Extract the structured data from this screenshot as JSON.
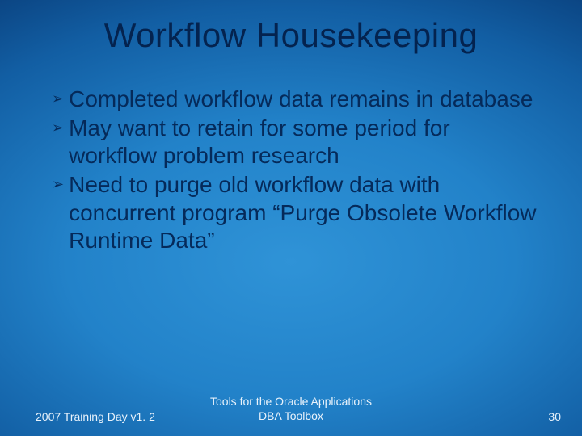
{
  "title": "Workflow Housekeeping",
  "bullets": {
    "b0": "Completed workflow data remains in database",
    "b1": "May want to retain for some period for workflow problem research",
    "b2": "Need to purge old workflow data with concurrent program “Purge Obsolete Workflow Runtime Data”"
  },
  "footer": {
    "left": "2007 Training Day v1. 2",
    "center_line1": "Tools for the Oracle Applications",
    "center_line2": "DBA Toolbox",
    "page": "30"
  }
}
